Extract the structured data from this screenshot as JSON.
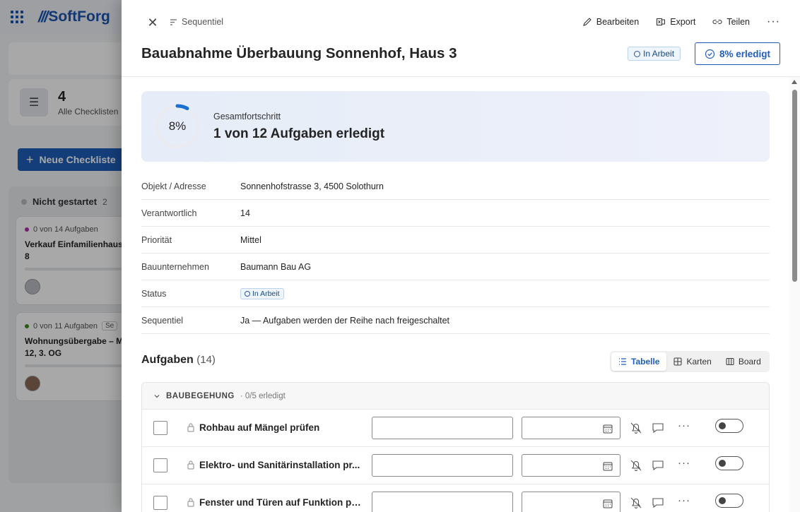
{
  "background": {
    "logo_text": "SoftForg",
    "stat": {
      "value": "4",
      "label": "Alle Checklisten"
    },
    "new_button_label": "Neue Checkliste",
    "column": {
      "title": "Nicht gestartet",
      "count": "2"
    },
    "cards": [
      {
        "meta": "0 von 14 Aufgaben",
        "dot_color": "#b02cb0",
        "title": "Verkauf Einfamilienhaus",
        "title_line2": "8"
      },
      {
        "meta": "0 von 11 Aufgaben",
        "dot_color": "#3a8a1f",
        "chip": "Se",
        "title": "Wohnungsübergabe – M",
        "title_line2": "12, 3. OG"
      }
    ]
  },
  "panel": {
    "seq_tag": "Sequentiel",
    "actions": {
      "edit": "Bearbeiten",
      "export": "Export",
      "share": "Teilen"
    },
    "title": "Bauabnahme Überbauung Sonnenhof, Haus 3",
    "status": "In Arbeit",
    "done_button": "8% erledigt",
    "progress": {
      "percent_label": "8%",
      "percent_value": 8,
      "label": "Gesamtfortschritt",
      "value": "1 von 12 Aufgaben erledigt"
    },
    "details": [
      {
        "label": "Objekt / Adresse",
        "value": "Sonnenhofstrasse 3, 4500 Solothurn"
      },
      {
        "label": "Verantwortlich",
        "value": "14"
      },
      {
        "label": "Priorität",
        "value": "Mittel"
      },
      {
        "label": "Bauunternehmen",
        "value": "Baumann Bau AG"
      },
      {
        "label": "Status",
        "value": "In Arbeit"
      },
      {
        "label": "Sequentiel",
        "value": "Ja — Aufgaben werden der Reihe nach freigeschaltet"
      }
    ],
    "tasks_title": "Aufgaben",
    "tasks_count": "(14)",
    "views": {
      "table": "Tabelle",
      "cards": "Karten",
      "board": "Board"
    },
    "group": {
      "title": "BAUBEGEHUNG",
      "subtitle": "· 0/5 erledigt"
    },
    "tasks": [
      {
        "name": "Rohbau auf Mängel prüfen"
      },
      {
        "name": "Elektro- und Sanitärinstallation pr..."
      },
      {
        "name": "Fenster und Türen auf Funktion pr..."
      }
    ]
  },
  "colors": {
    "accent": "#1f5fba",
    "progress_ring": "#1a6fd0"
  }
}
